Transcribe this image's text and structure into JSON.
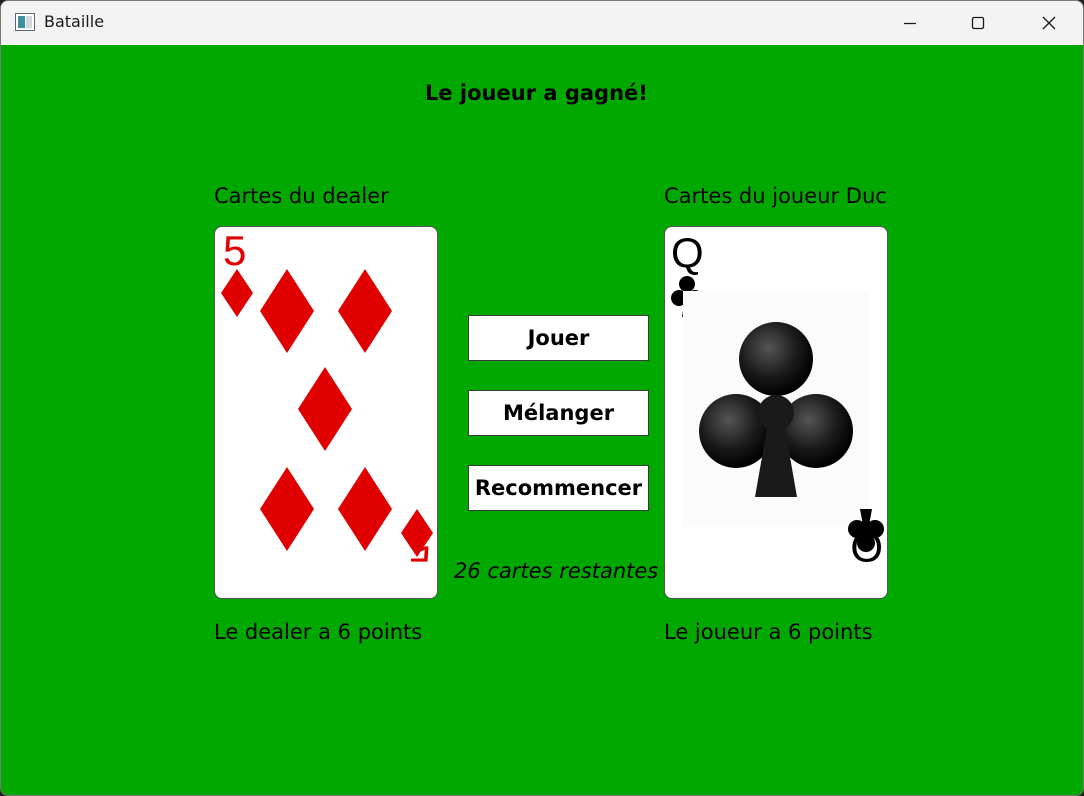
{
  "window": {
    "title": "Bataille",
    "controls": [
      "minimize-icon",
      "maximize-icon",
      "close-icon"
    ]
  },
  "game": {
    "message": "Le joueur a gagné!",
    "dealer": {
      "label": "Cartes du dealer",
      "card": {
        "rank": "5",
        "suit": "diamonds",
        "color": "#e00000"
      },
      "score_text": "Le dealer a 6 points"
    },
    "player": {
      "label": "Cartes du joueur Duc",
      "card": {
        "rank": "Q",
        "suit": "clubs",
        "color": "#000000"
      },
      "score_text": "Le joueur a 6 points"
    },
    "buttons": {
      "play": "Jouer",
      "shuffle": "Mélanger",
      "restart": "Recommencer"
    },
    "remaining": "26 cartes restantes"
  },
  "colors": {
    "table_green": "#00a800",
    "titlebar": "#f3f3f3",
    "diamond_red": "#e00000"
  }
}
